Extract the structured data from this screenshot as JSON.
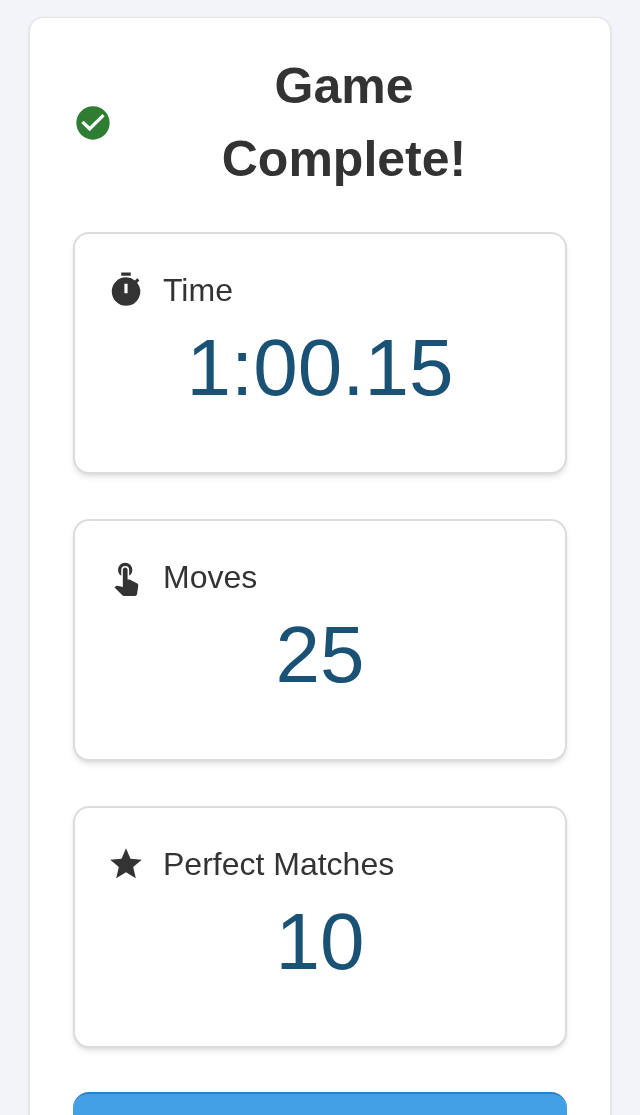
{
  "title": "Game Complete!",
  "stats": [
    {
      "kind": "time",
      "label": "Time",
      "value": "1:00.15"
    },
    {
      "kind": "moves",
      "label": "Moves",
      "value": "25"
    },
    {
      "kind": "perfect",
      "label": "Perfect Matches",
      "value": "10"
    }
  ]
}
